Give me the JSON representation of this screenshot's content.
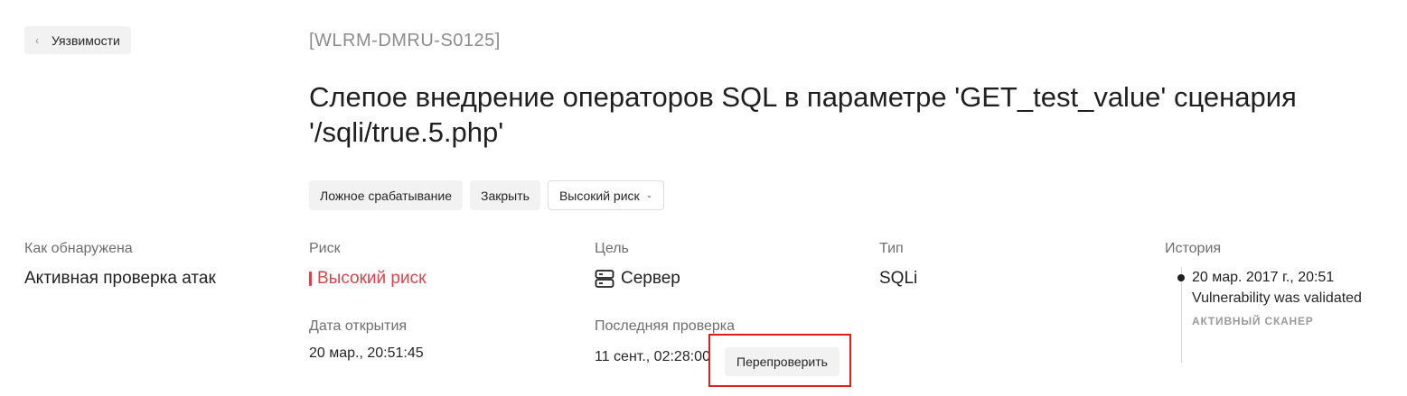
{
  "nav": {
    "back_label": "Уязвимости"
  },
  "vulnerability": {
    "id": "[WLRM-DMRU-S0125]",
    "title": "Слепое внедрение операторов SQL в параметре 'GET_test_value' сценария '/sqli/true.5.php'"
  },
  "actions": {
    "false_positive": "Ложное срабатывание",
    "close": "Закрыть",
    "risk_dropdown": "Высокий риск"
  },
  "details": {
    "detected": {
      "label": "Как обнаружена",
      "value": "Активная проверка атак"
    },
    "risk": {
      "label": "Риск",
      "value": "Высокий риск",
      "color": "#d9444b"
    },
    "opened": {
      "label": "Дата открытия",
      "value": "20 мар., 20:51:45"
    },
    "target": {
      "label": "Цель",
      "value": "Сервер",
      "icon": "server-icon"
    },
    "last_check": {
      "label": "Последняя проверка",
      "value": "11 сент., 02:28:00",
      "recheck_label": "Перепроверить"
    },
    "type": {
      "label": "Тип",
      "value": "SQLi"
    }
  },
  "history": {
    "label": "История",
    "entries": [
      {
        "date": "20 мар. 2017 г., 20:51",
        "text": "Vulnerability was validated",
        "source": "АКТИВНЫЙ СКАНЕР"
      }
    ]
  }
}
